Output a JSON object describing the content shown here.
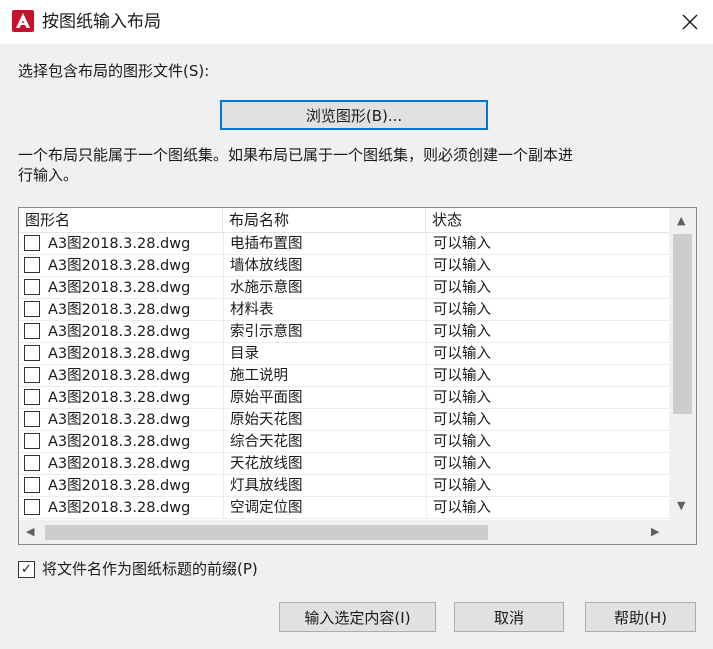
{
  "window": {
    "title": "按图纸输入布局",
    "close_glyph": "✕"
  },
  "select_label": "选择包含布局的图形文件(S):",
  "browse_button": "浏览图形(B)...",
  "info_text_line1": "一个布局只能属于一个图纸集。如果布局已属于一个图纸集，则必须创建一个副本进",
  "info_text_line2": "行输入。",
  "table": {
    "headers": [
      "图形名",
      "布局名称",
      "状态"
    ],
    "rows": [
      {
        "file": "A3图2018.3.28.dwg",
        "layout": "电插布置图",
        "status": "可以输入"
      },
      {
        "file": "A3图2018.3.28.dwg",
        "layout": "墙体放线图",
        "status": "可以输入"
      },
      {
        "file": "A3图2018.3.28.dwg",
        "layout": "水施示意图",
        "status": "可以输入"
      },
      {
        "file": "A3图2018.3.28.dwg",
        "layout": "材料表",
        "status": "可以输入"
      },
      {
        "file": "A3图2018.3.28.dwg",
        "layout": "索引示意图",
        "status": "可以输入"
      },
      {
        "file": "A3图2018.3.28.dwg",
        "layout": "目录",
        "status": "可以输入"
      },
      {
        "file": "A3图2018.3.28.dwg",
        "layout": "施工说明",
        "status": "可以输入"
      },
      {
        "file": "A3图2018.3.28.dwg",
        "layout": "原始平面图",
        "status": "可以输入"
      },
      {
        "file": "A3图2018.3.28.dwg",
        "layout": "原始天花图",
        "status": "可以输入"
      },
      {
        "file": "A3图2018.3.28.dwg",
        "layout": "综合天花图",
        "status": "可以输入"
      },
      {
        "file": "A3图2018.3.28.dwg",
        "layout": "天花放线图",
        "status": "可以输入"
      },
      {
        "file": "A3图2018.3.28.dwg",
        "layout": "灯具放线图",
        "status": "可以输入"
      },
      {
        "file": "A3图2018.3.28.dwg",
        "layout": "空调定位图",
        "status": "可以输入"
      }
    ]
  },
  "prefix_checkbox": {
    "label": "将文件名作为图纸标题的前缀(P)",
    "checked": true,
    "glyph": "✓"
  },
  "buttons": {
    "import": "输入选定内容(I)",
    "cancel": "取消",
    "help": "帮助(H)"
  },
  "scroll_glyphs": {
    "up": "▲",
    "down": "▼",
    "left": "◀",
    "right": "▶"
  },
  "colors": {
    "accent": "#0078d7",
    "app_icon": "#c8102e"
  }
}
